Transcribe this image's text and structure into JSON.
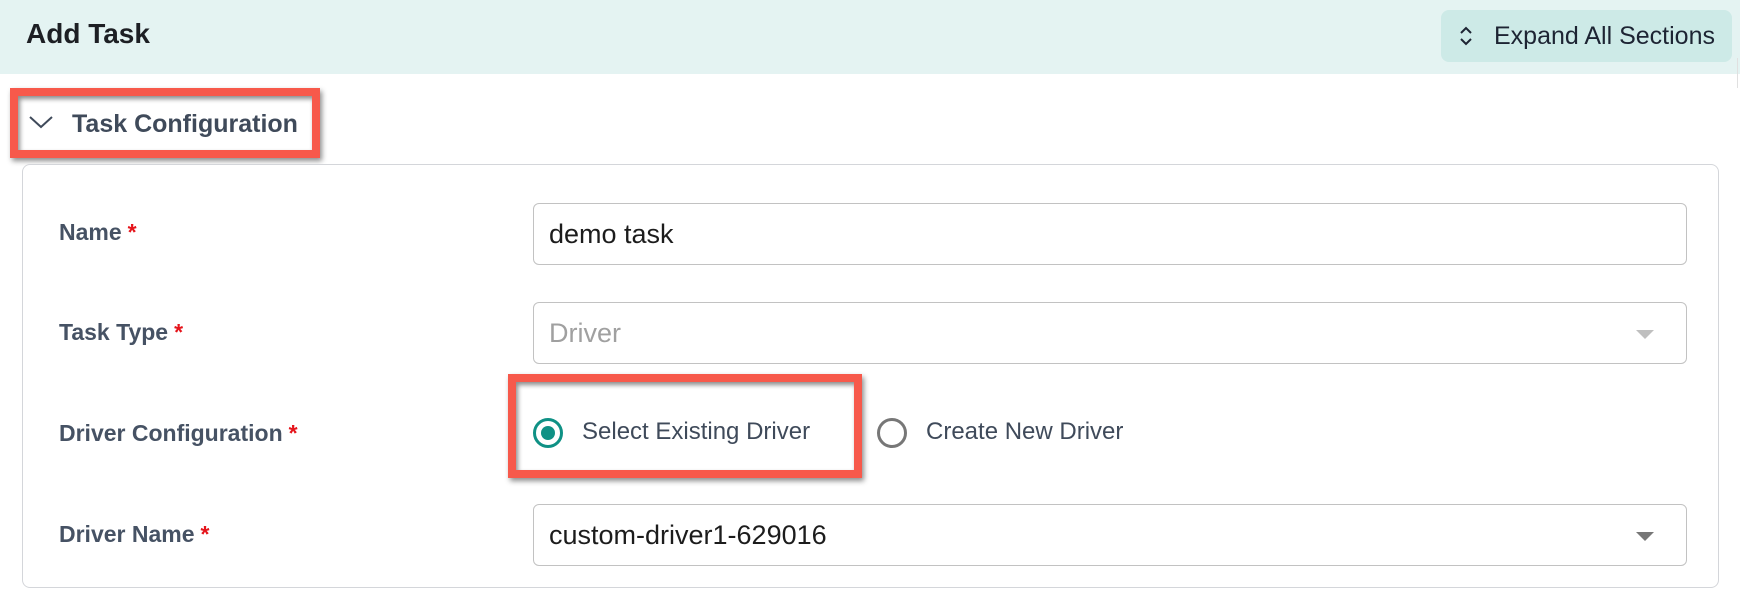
{
  "header": {
    "title": "Add Task",
    "expand_all_label": "Expand All Sections",
    "expand_icon": "chevron-up-down-icon"
  },
  "section": {
    "title": "Task Configuration",
    "toggle_icon": "chevron-down-icon",
    "expanded": true
  },
  "form": {
    "required_marker": "*",
    "name": {
      "label": "Name",
      "value": "demo task"
    },
    "task_type": {
      "label": "Task Type",
      "value": "Driver",
      "disabled": true
    },
    "driver_configuration": {
      "label": "Driver Configuration",
      "options": [
        {
          "label": "Select Existing Driver",
          "checked": true
        },
        {
          "label": "Create New Driver",
          "checked": false
        }
      ]
    },
    "driver_name": {
      "label": "Driver Name",
      "value": "custom-driver1-629016"
    }
  },
  "colors": {
    "header_bg": "#e4f3f2",
    "button_bg": "#cdeae7",
    "accent": "#0f9185",
    "required": "#e5141b",
    "annotation": "#f7594b"
  }
}
